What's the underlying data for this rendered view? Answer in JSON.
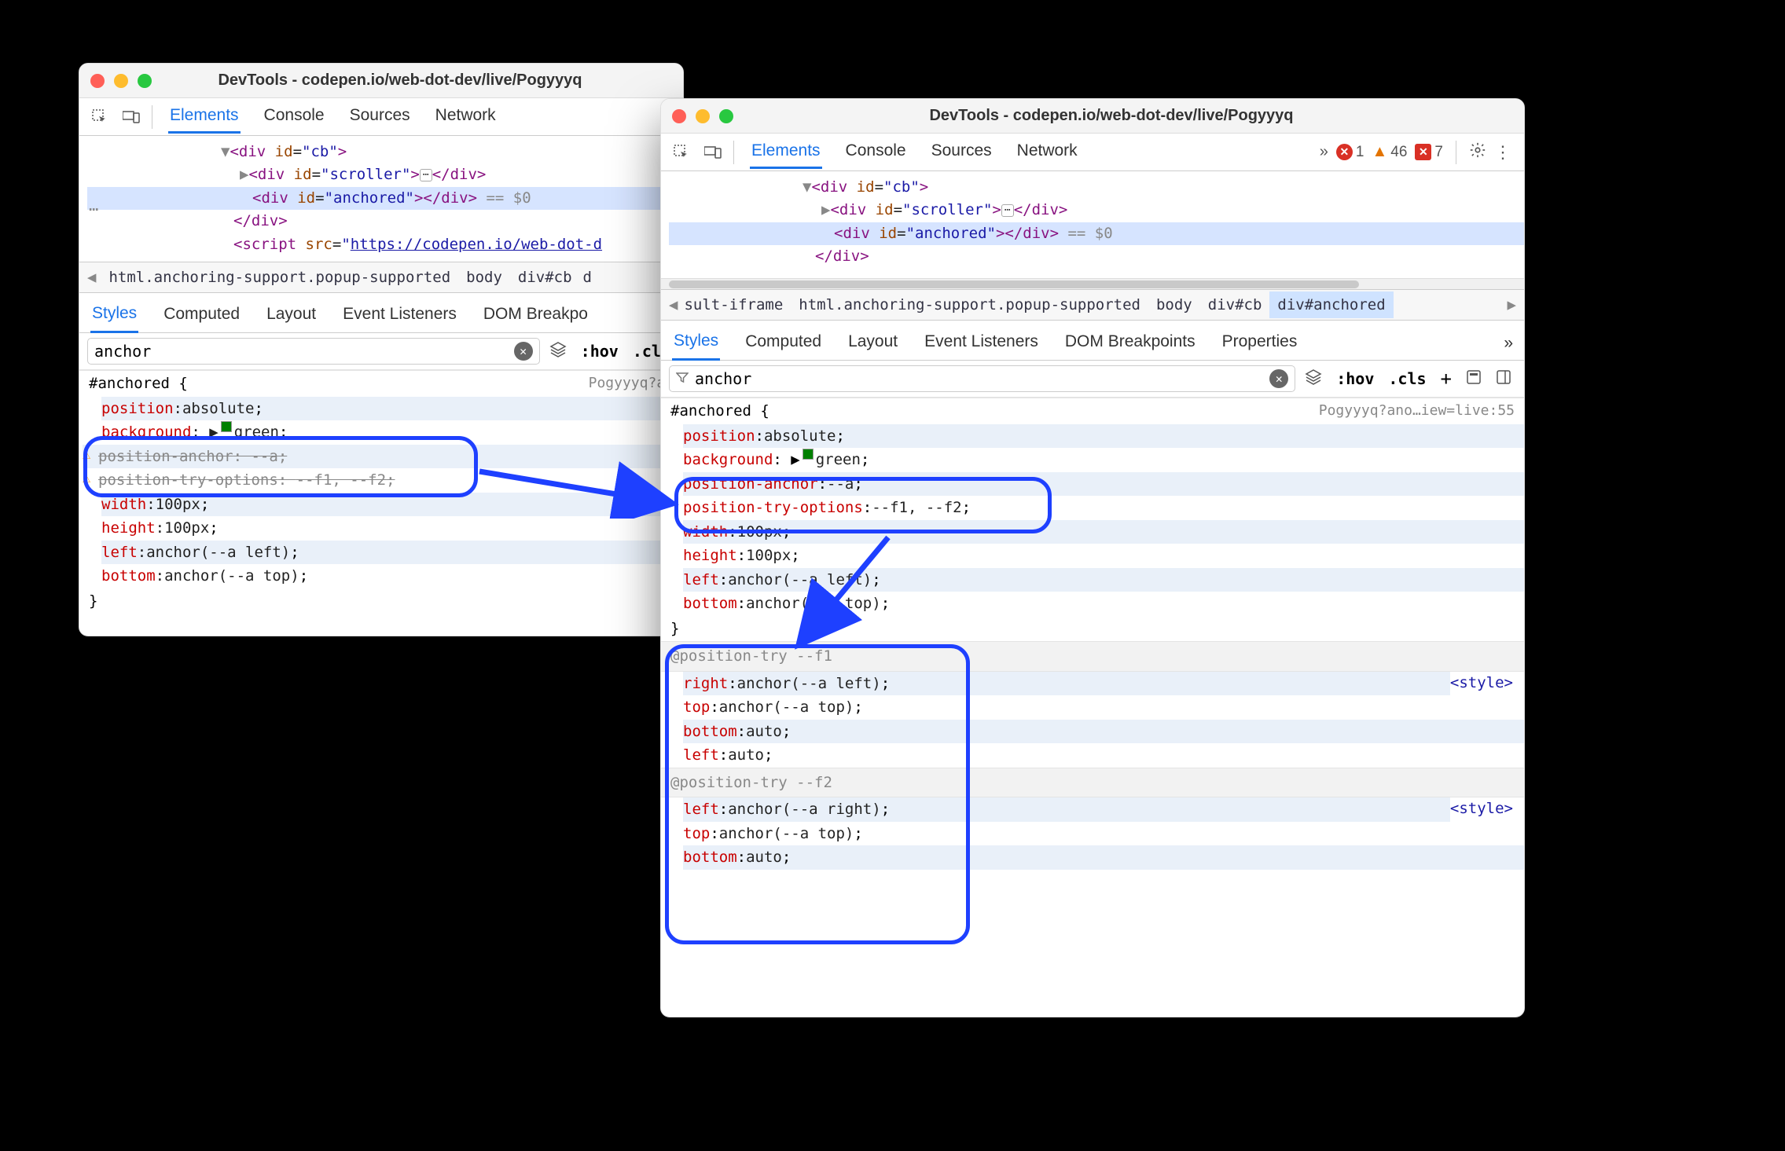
{
  "window_title": "DevTools - codepen.io/web-dot-dev/live/Pogyyyq",
  "toolbar_tabs": [
    "Elements",
    "Console",
    "Sources",
    "Network"
  ],
  "moreglyph": "»",
  "errors": {
    "err_count": "1",
    "warn_count": "46",
    "msg_count": "7"
  },
  "dom": {
    "line1_open": "<div id=\"cb\">",
    "line2_open": "<div id=\"scroller\">",
    "line2_close": "</div>",
    "line3_open": "<div id=\"anchored\">",
    "line3_close": "</div>",
    "eq_sel": "== $0",
    "line4": "</div>",
    "script_open": "<script src=\"",
    "script_url": "https://codepen.io/web-dot-d",
    "dots": "…"
  },
  "crumbs_left": {
    "items": [
      "html.anchoring-support.popup-supported",
      "body",
      "div#cb"
    ],
    "cutoff": "d"
  },
  "crumbs_right_prefix": "sult-iframe",
  "crumbs_right": [
    "html.anchoring-support.popup-supported",
    "body",
    "div#cb",
    "div#anchored"
  ],
  "subtabs_left": [
    "Styles",
    "Computed",
    "Layout",
    "Event Listeners",
    "DOM Breakpo"
  ],
  "subtabs_right": [
    "Styles",
    "Computed",
    "Layout",
    "Event Listeners",
    "DOM Breakpoints",
    "Properties"
  ],
  "filter_value": "anchor",
  "filter_icons": {
    "hov": ":hov",
    "cls": ".cls"
  },
  "src_left": "Pogyyyq?an",
  "src_right": "Pogyyyq?ano…iew=live:55",
  "selector": "#anchored {",
  "decl_common": {
    "position": {
      "p": "position",
      "v": "absolute"
    },
    "background": {
      "p": "background",
      "v": "green"
    },
    "width": {
      "p": "width",
      "v": "100px"
    },
    "height": {
      "p": "height",
      "v": "100px"
    },
    "left": {
      "p": "left",
      "v": "anchor(--a left)"
    },
    "bottom": {
      "p": "bottom",
      "v": "anchor(--a top)"
    }
  },
  "decl_strike1": {
    "p": "position-anchor",
    "v": "--a"
  },
  "decl_strike2": {
    "p": "position-try-options",
    "v": "--f1, --f2"
  },
  "decl_right_anchor": {
    "p": "position-anchor",
    "v": "--a"
  },
  "decl_right_tryopts": {
    "p": "position-try-options",
    "v": "--f1, --f2"
  },
  "closebrace": "}",
  "postry1_header": "@position-try --f1",
  "postry1": {
    "right": {
      "p": "right",
      "v": "anchor(--a left)"
    },
    "top": {
      "p": "top",
      "v": "anchor(--a top)"
    },
    "bottom": {
      "p": "bottom",
      "v": "auto"
    },
    "left": {
      "p": "left",
      "v": "auto"
    }
  },
  "postry2_header": "@position-try --f2",
  "postry2": {
    "left": {
      "p": "left",
      "v": "anchor(--a right)"
    },
    "top": {
      "p": "top",
      "v": "anchor(--a top)"
    },
    "bottom": {
      "p": "bottom",
      "v": "auto"
    }
  },
  "stylelink": "<style>"
}
